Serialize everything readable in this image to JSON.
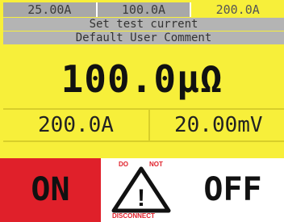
{
  "tabs": [
    {
      "label": "25.00A"
    },
    {
      "label": "100.0A"
    },
    {
      "label": "200.0A"
    }
  ],
  "active_tab": "200.0A",
  "status": {
    "prompt": "Set test current",
    "comment": "Default User Comment"
  },
  "reading": {
    "resistance": "100.0μΩ",
    "current": "200.0A",
    "voltage": "20.00mV"
  },
  "controls": {
    "on_label": "ON",
    "off_label": "OFF",
    "warning_top_left": "DO",
    "warning_top_right": "NOT",
    "warning_bottom": "DISCONNECT",
    "warning_symbol": "!"
  },
  "colors": {
    "screen_background": "#f7ef3a",
    "bar_gray": "#b4b4b4",
    "on_red": "#e0202a",
    "warning_red": "#e0202a"
  },
  "icons": {
    "warning": "warning-triangle-icon"
  }
}
